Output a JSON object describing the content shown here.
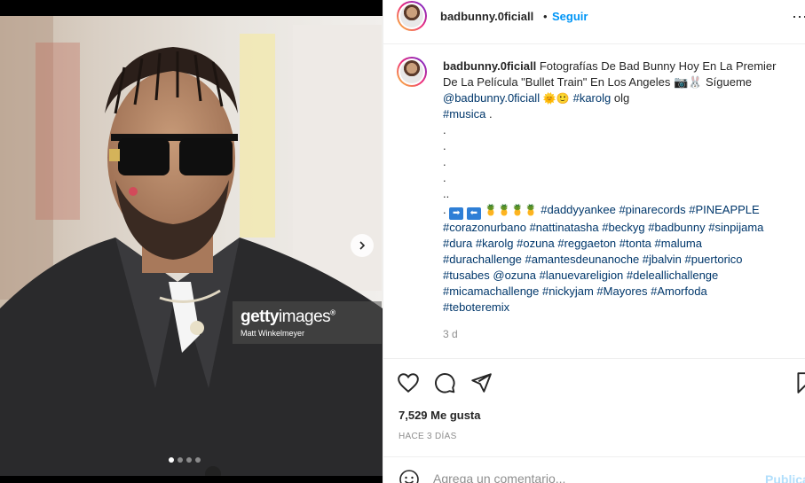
{
  "post": {
    "username": "badbunny.0ficiall",
    "separator": "•",
    "follow_label": "Seguir",
    "more_label": "• • •"
  },
  "photo": {
    "getty_brand_bold": "getty",
    "getty_brand_light": "images",
    "getty_reg": "®",
    "getty_credit": "Matt Winkelmeyer",
    "carousel_index": 1,
    "carousel_count": 4
  },
  "caption": {
    "username": "badbunny.0ficiall",
    "line1": " Fotografías De Bad Bunny Hoy En La Premier",
    "line2": "De La Película \"Bullet Train\" En Los Angeles 📷🐰 Sígueme",
    "line3_mention": "@badbunny.0ficiall",
    "line3_emoji": " 🌞🙂 ",
    "line3_tag": "#karolg",
    "line3_rest": " olg",
    "line4_tag": "#musica",
    "line4_rest": " .",
    "dot1": ".",
    "dot2": ".",
    "dot3": ".",
    "dot4": ".",
    "dot5": "..",
    "line10_prefix": ". ",
    "arrow_right": "➡",
    "arrow_left": "⬅",
    "pineapples": " 🍍🍍🍍🍍 ",
    "line10_tags": "#daddyyankee #pinarecords #PINEAPPLE",
    "line11": "#corazonurbano #nattinatasha #beckyg #badbunny #sinpijama",
    "line12": "#dura #karolg #ozuna #reggaeton #tonta  #maluma",
    "line13": "#durachallenge #amantesdeunanoche  #jbalvin #puertorico",
    "line14": "#tusabes @ozuna #lanuevareligion #deleallichallenge",
    "line15": "#micamachallenge #nickyjam #Mayores #Amorfoda",
    "line16": "#teboteremix",
    "age": "3 d"
  },
  "engagement": {
    "likes": "7,529 Me gusta",
    "timestamp": "HACE 3 DÍAS"
  },
  "comment": {
    "placeholder": "Agrega un comentario...",
    "publish_label": "Publicar"
  },
  "colors": {
    "link_blue": "#0095f6",
    "hashtag": "#00376b",
    "muted": "#8e8e8e"
  }
}
